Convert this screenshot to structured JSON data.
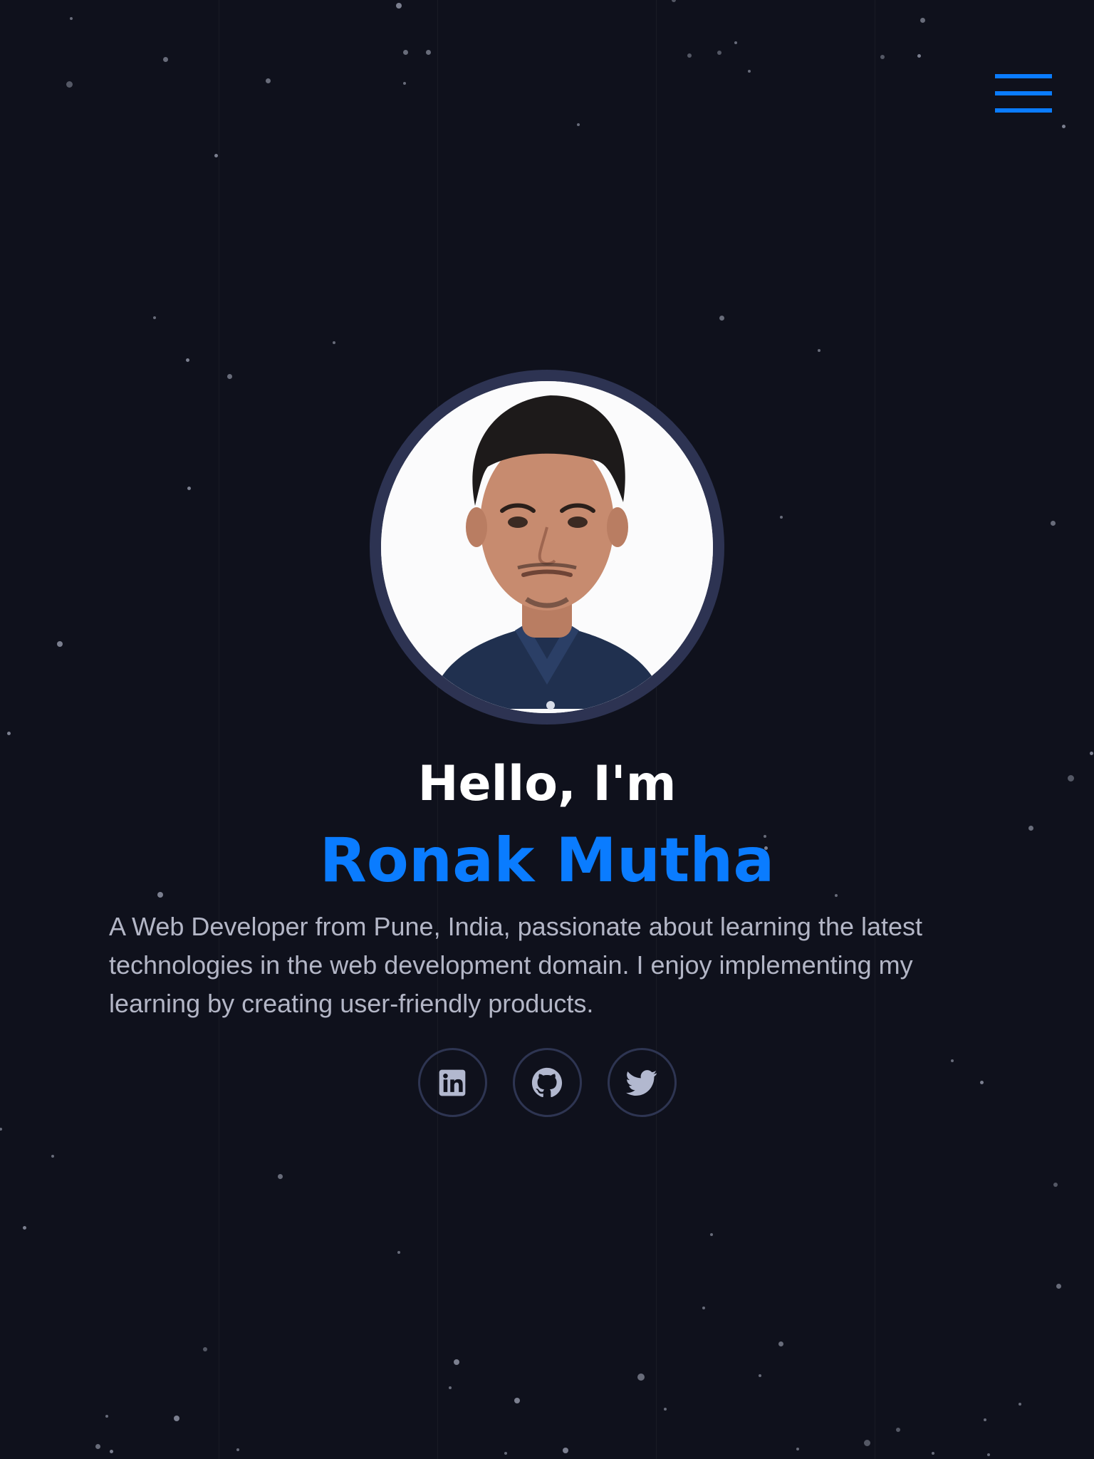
{
  "header": {
    "menu_icon": "hamburger-menu-icon",
    "accent": "#0a7cff"
  },
  "hero": {
    "avatar": {
      "icon": "profile-photo",
      "border_color": "#2d3352"
    },
    "greeting": "Hello, I'm",
    "name": "Ronak Mutha",
    "bio": "A Web Developer from Pune, India, passionate about learning the latest technologies in the web development domain. I enjoy implementing my learning by creating user-friendly products.",
    "social": [
      {
        "icon": "linkedin-icon"
      },
      {
        "icon": "github-icon"
      },
      {
        "icon": "twitter-icon"
      }
    ]
  },
  "theme": {
    "background": "#0f111c",
    "text": "#ffffff",
    "muted_text": "#b3b6c6",
    "accent": "#0a7cff"
  }
}
